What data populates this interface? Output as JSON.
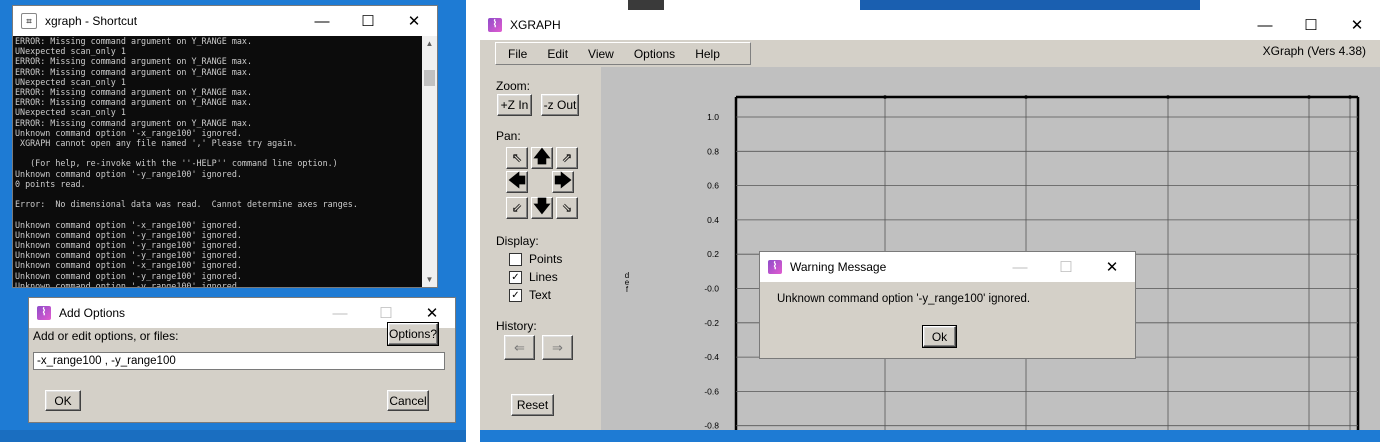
{
  "console": {
    "title": "xgraph - Shortcut",
    "lines": [
      "ERROR: Missing command argument on Y_RANGE max.",
      "UNexpected scan_only 1",
      "ERROR: Missing command argument on Y_RANGE max.",
      "ERROR: Missing command argument on Y_RANGE max.",
      "UNexpected scan_only 1",
      "ERROR: Missing command argument on Y_RANGE max.",
      "ERROR: Missing command argument on Y_RANGE max.",
      "UNexpected scan_only 1",
      "ERROR: Missing command argument on Y_RANGE max.",
      "Unknown command option '-x_range100' ignored.",
      " XGRAPH cannot open any file named ',' Please try again.",
      "",
      "   (For help, re-invoke with the ''-HELP'' command line option.)",
      "Unknown command option '-y_range100' ignored.",
      "0 points read.",
      "",
      "Error:  No dimensional data was read.  Cannot determine axes ranges.",
      "",
      "Unknown command option '-x_range100' ignored.",
      "Unknown command option '-y_range100' ignored.",
      "Unknown command option '-y_range100' ignored.",
      "Unknown command option '-y_range100' ignored.",
      "Unknown command option '-x_range100' ignored.",
      "Unknown command option '-y_range100' ignored.",
      "Unknown command option '-y_range100' ignored."
    ]
  },
  "add_options": {
    "title": "Add Options",
    "prompt": "Add or edit options, or files:",
    "options_button": "Options?",
    "input_value": "-x_range100 , -y_range100",
    "ok_button": "OK",
    "cancel_button": "Cancel"
  },
  "xgraph": {
    "title": "XGRAPH",
    "menu": [
      "File",
      "Edit",
      "View",
      "Options",
      "Help"
    ],
    "version": "XGraph (Vers 4.38)",
    "zoom_label": "Zoom:",
    "zoom_in": "+Z In",
    "zoom_out": "-z Out",
    "pan_label": "Pan:",
    "display_label": "Display:",
    "display_options": [
      {
        "label": "Points",
        "checked": false
      },
      {
        "label": "Lines",
        "checked": true
      },
      {
        "label": "Text",
        "checked": true
      }
    ],
    "history_label": "History:",
    "reset_button": "Reset",
    "y_axis_text": "d e f",
    "y_ticks": [
      "1.0",
      "0.8",
      "0.6",
      "0.4",
      "0.2",
      "-0.0",
      "-0.2",
      "-0.4",
      "-0.6",
      "-0.8"
    ],
    "y_tick_values": [
      1.0,
      0.8,
      0.6,
      0.4,
      0.2,
      0.0,
      -0.2,
      -0.4,
      -0.6,
      -0.8
    ]
  },
  "warning": {
    "title": "Warning Message",
    "message": "Unknown command option '-y_range100' ignored.",
    "ok_button": "Ok"
  },
  "colors": {
    "desktop": "#1e7bd4",
    "console_bg": "#0c0c0c",
    "console_text": "#cccccc",
    "dialog_bg": "#d4d0c8",
    "plot_bg": "#c0c0c0"
  }
}
